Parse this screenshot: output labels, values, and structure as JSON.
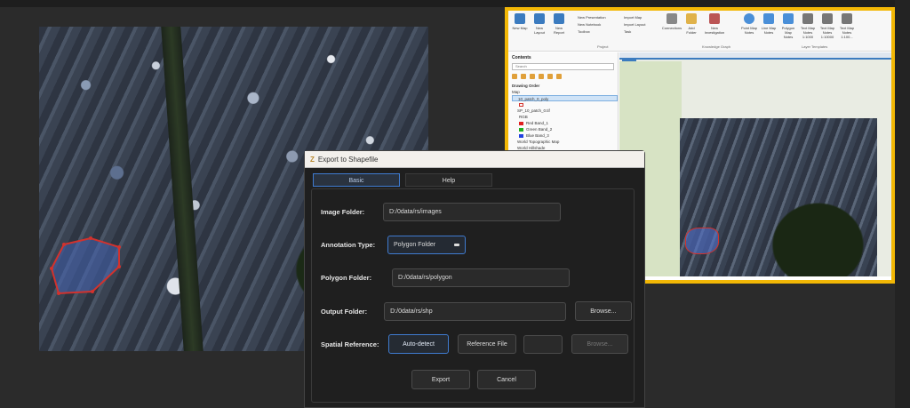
{
  "dialog": {
    "title": "Export to Shapefile",
    "tabs": [
      "Basic",
      "Help"
    ],
    "labels": {
      "image_folder": "Image Folder:",
      "annotation_type": "Annotation Type:",
      "polygon_folder": "Polygon Folder:",
      "output_folder": "Output Folder:",
      "spatial_reference": "Spatial Reference:"
    },
    "values": {
      "image_folder": "D:/0data/rs/images",
      "annotation_type": "Polygon Folder",
      "polygon_folder": "D:/0data/rs/polygon",
      "output_folder": "D:/0data/rs/shp"
    },
    "buttons": {
      "browse": "Browse...",
      "auto_detect": "Auto-detect",
      "reference_file": "Reference File",
      "browse_disabled": "Browse...",
      "export": "Export",
      "cancel": "Cancel"
    }
  },
  "arcgis": {
    "ribbon_groups": [
      "Project",
      "Knowledge Graph",
      "Layer Templates"
    ],
    "ribbon_buttons": [
      "New Map",
      "New Layout",
      "New Report",
      "New Presentation",
      "New Notebook",
      "Toolbox",
      "Import Map",
      "Import Layout",
      "Task",
      "Connections",
      "Add Folder",
      "New Investigation",
      "Point Map Notes",
      "Line Map Notes",
      "Polygon Map Notes",
      "Text Map Notes 1:1000",
      "Text Map Notes 1:10000",
      "Text Map Notes 1:100..."
    ],
    "contents": {
      "title": "Contents",
      "search_placeholder": "Search",
      "drawing_order": "Drawing Order",
      "layers": [
        "Map",
        "10_patch_0_poly",
        "SP_10_patch_0.tif",
        "RGB",
        "Red Band_1",
        "Green Band_2",
        "Blue Band_3",
        "World Topographic Map",
        "World Hillshade"
      ]
    },
    "map_tab": "Map"
  },
  "colors": {
    "highlight": "#f2b705",
    "accent": "#3f7bd0",
    "arrow": "#e0302a",
    "polygon_edge": "#d2322d"
  }
}
